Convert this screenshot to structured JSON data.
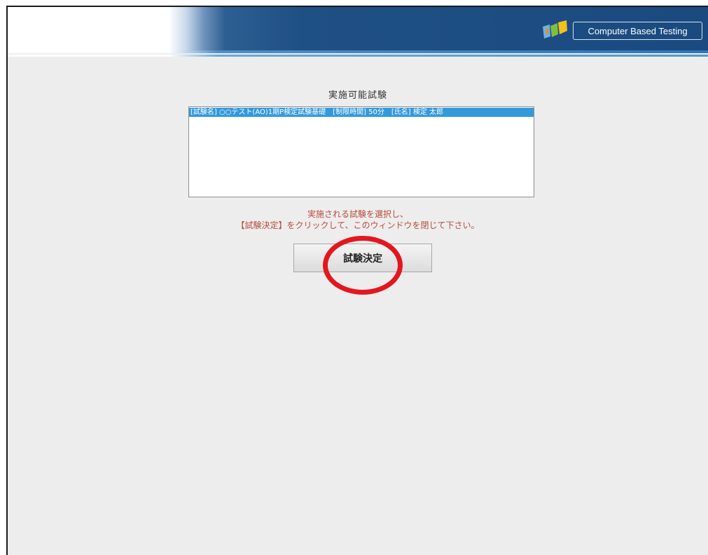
{
  "banner": {
    "brand_label": "Computer Based Testing",
    "brand_color": "#1a4a80",
    "logo_icon": "cbt-logo-icon"
  },
  "main": {
    "title": "実施可能試験",
    "exam_list": {
      "items": [
        "[試験名] ○○テスト(AO)1期P検定試験基礎　[制限時間] 50分　[氏名] 検定 太郎"
      ],
      "selected_index": 0
    },
    "instruction_line1": "実施される試験を選択し、",
    "instruction_line2": "【試験決定】をクリックして、このウィンドウを閉じて下さい。",
    "decide_button_label": "試験決定"
  },
  "annotation": {
    "circle_color": "#e4161f"
  }
}
